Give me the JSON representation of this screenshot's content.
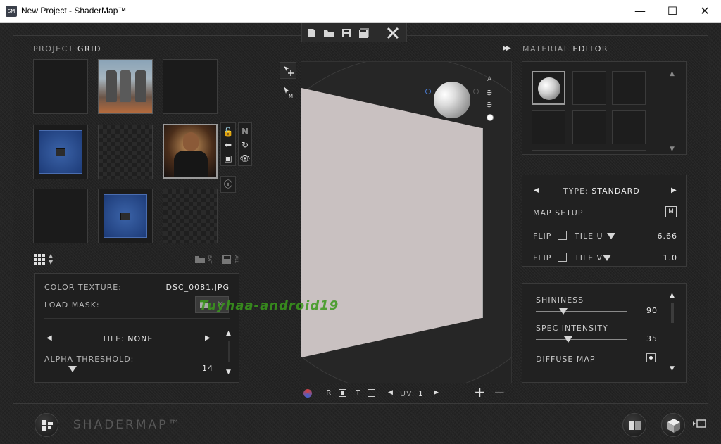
{
  "window": {
    "title": "New Project - ShaderMap™",
    "app_icon_text": "SM",
    "minimize": "—",
    "maximize": "☐",
    "close": "✕"
  },
  "toolbar": {
    "new_icon": "new-file-icon",
    "open_icon": "folder-open-icon",
    "save_icon": "save-icon",
    "save_all_icon": "save-all-icon",
    "tools_icon": "tools-icon"
  },
  "project_grid": {
    "title_prefix": "PROJECT",
    "title_main": "GRID"
  },
  "texture_panel": {
    "color_texture_label": "COLOR TEXTURE:",
    "color_texture_value": "DSC_0081.JPG",
    "load_mask_label": "LOAD MASK:",
    "tile_label": "TILE:",
    "tile_value": "NONE",
    "alpha_label": "ALPHA THRESHOLD:",
    "alpha_value": "14",
    "alpha_level": 0.2
  },
  "grid_footer": {
    "bat_label": "BAT",
    "all_label": "ALL"
  },
  "viewport": {
    "r_label": "R",
    "t_label": "T",
    "uv_label": "UV:",
    "uv_value": "1",
    "zoom_in": "+",
    "zoom_out": "−",
    "a_label": "A"
  },
  "material_editor": {
    "title_prefix": "MATERIAL",
    "title_main": "EDITOR",
    "type_label": "TYPE:",
    "type_value": "STANDARD",
    "map_setup_label": "MAP SETUP",
    "flip_label": "FLIP",
    "tile_u_label": "TILE U",
    "tile_u_value": "6.66",
    "tile_u_level": 0.1,
    "tile_v_label": "TILE V",
    "tile_v_value": "1.0",
    "tile_v_level": 0.0,
    "shininess_label": "SHININESS",
    "shininess_value": "90",
    "shininess_level": 0.3,
    "spec_label": "SPEC INTENSITY",
    "spec_value": "35",
    "spec_level": 0.35,
    "diffuse_label": "DIFFUSE MAP"
  },
  "footer": {
    "brand": "SHADERMAP™"
  },
  "watermark": "Tuyhaa-android19",
  "colors": {
    "accent_blue": "#2d4f90",
    "watermark_green": "#3a9a1c",
    "panel_bg": "#212121"
  }
}
